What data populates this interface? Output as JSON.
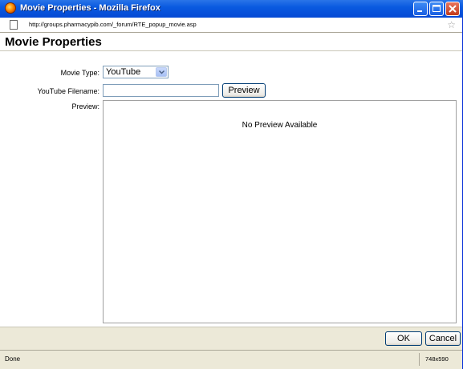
{
  "window": {
    "title": "Movie Properties - Mozilla Firefox"
  },
  "addressbar": {
    "url": "http://groups.pharmacypib.com/_forum/RTE_popup_movie.asp"
  },
  "page": {
    "heading": "Movie Properties",
    "movie_type_label": "Movie Type:",
    "movie_type_value": "YouTube",
    "filename_label": "YouTube Filename:",
    "filename_value": "",
    "preview_button": "Preview",
    "preview_label": "Preview:",
    "preview_message": "No Preview Available"
  },
  "footer": {
    "ok_label": "OK",
    "cancel_label": "Cancel"
  },
  "statusbar": {
    "status": "Done",
    "dimensions": "748x590"
  },
  "icons": {
    "app": "firefox-icon",
    "page": "page-icon",
    "bookmark": "star-icon",
    "minimize": "minimize-icon",
    "maximize": "maximize-icon",
    "close": "close-icon",
    "dropdown": "chevron-down-icon"
  },
  "colors": {
    "titlebar": "#0a5ae0",
    "window_bg": "#ece9d8",
    "close_button": "#c23b1a"
  }
}
